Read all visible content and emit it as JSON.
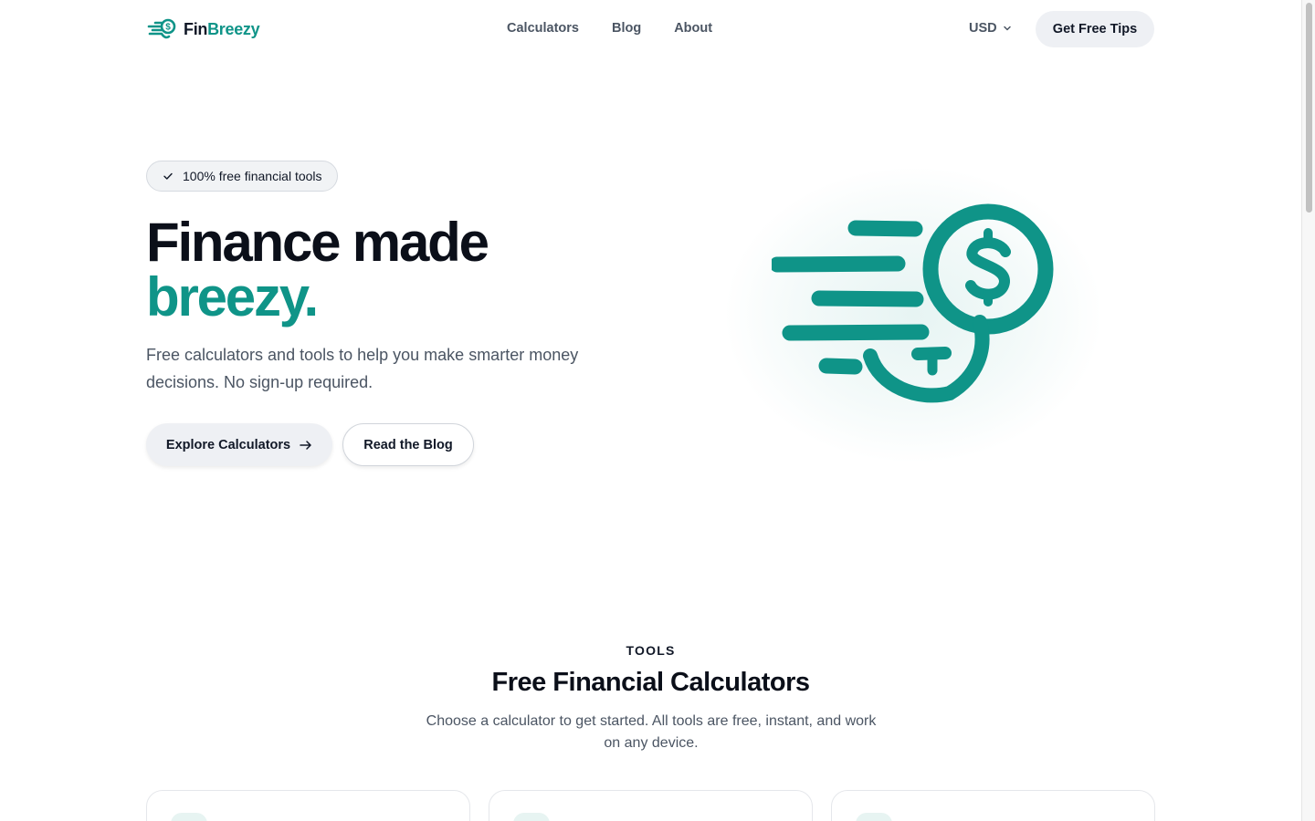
{
  "header": {
    "logo_fin": "Fin",
    "logo_breezy": "Breezy",
    "nav": [
      "Calculators",
      "Blog",
      "About"
    ],
    "currency": "USD",
    "cta": "Get Free Tips"
  },
  "hero": {
    "badge": "100% free financial tools",
    "title_line1": "Finance made",
    "title_line2": "breezy.",
    "subtitle": "Free calculators and tools to help you make smarter money decisions. No sign-up required.",
    "primary_button": "Explore Calculators",
    "secondary_button": "Read the Blog",
    "illustration_icon": "dollar-coin-speed-icon"
  },
  "tools": {
    "eyebrow": "TOOLS",
    "title": "Free Financial Calculators",
    "subtitle": "Choose a calculator to get started. All tools are free, instant, and work on any device."
  },
  "colors": {
    "brand": "#0f9488",
    "text": "#111827",
    "muted": "#4b5563",
    "button_bg": "#eef0f4"
  }
}
